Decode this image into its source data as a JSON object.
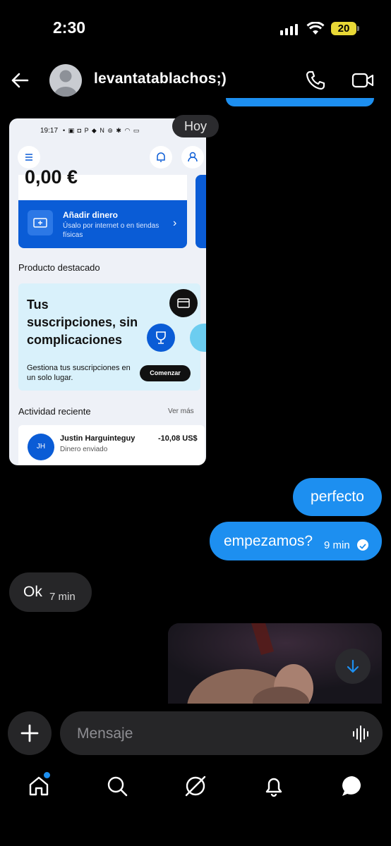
{
  "status_bar": {
    "time": "2:30",
    "battery": "20"
  },
  "header": {
    "title": "levantatablachos;)"
  },
  "day_separator": "Hoy",
  "embedded_screenshot": {
    "time": "19:17",
    "status_icons": "• ▣ ◘ P ◆  N ⊚ ✱ ◠ ▭",
    "balance": "0,00 €",
    "add_money_title": "Añadir dinero",
    "add_money_subtitle": "Úsalo por internet o en tiendas físicas",
    "featured_heading": "Producto destacado",
    "promo_title": "Tus suscripciones, sin complicaciones",
    "promo_subtitle": "Gestiona tus suscripciones en un solo lugar.",
    "promo_button": "Comenzar",
    "recent_heading": "Actividad reciente",
    "see_more": "Ver más",
    "transaction": {
      "initials": "JH",
      "name": "Justin Harguinteguy",
      "description": "Dinero enviado",
      "amount": "-10,08 US$"
    }
  },
  "messages": [
    {
      "direction": "out",
      "text": "perfecto"
    },
    {
      "direction": "out",
      "text": "empezamos?",
      "time": "9 min",
      "read": true
    },
    {
      "direction": "in",
      "text": "Ok",
      "time": "7 min"
    }
  ],
  "composer": {
    "placeholder": "Mensaje"
  },
  "colors": {
    "accent": "#1d8ff0",
    "bubble_in": "#262628",
    "background": "#000000"
  },
  "tab_bar": [
    "home-icon",
    "search-icon",
    "explore-icon",
    "bell-icon",
    "messages-icon"
  ]
}
